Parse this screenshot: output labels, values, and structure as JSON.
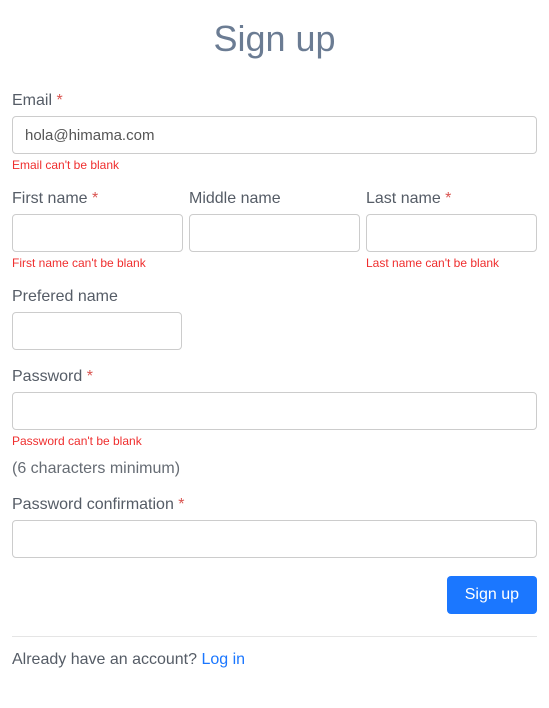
{
  "title": "Sign up",
  "fields": {
    "email": {
      "label": "Email",
      "required_mark": "*",
      "value": "hola@himama.com",
      "error": "Email can't be blank"
    },
    "first_name": {
      "label": "First name",
      "required_mark": "*",
      "value": "",
      "error": "First name can't be blank"
    },
    "middle_name": {
      "label": "Middle name",
      "value": ""
    },
    "last_name": {
      "label": "Last name",
      "required_mark": "*",
      "value": "",
      "error": "Last name can't be blank"
    },
    "preferred_name": {
      "label": "Prefered name",
      "value": ""
    },
    "password": {
      "label": "Password",
      "required_mark": "*",
      "value": "",
      "error": "Password can't be blank",
      "hint": "(6 characters minimum)"
    },
    "password_confirmation": {
      "label": "Password confirmation",
      "required_mark": "*",
      "value": ""
    }
  },
  "submit_label": "Sign up",
  "login_prompt": "Already have an account? ",
  "login_link_label": "Log in"
}
